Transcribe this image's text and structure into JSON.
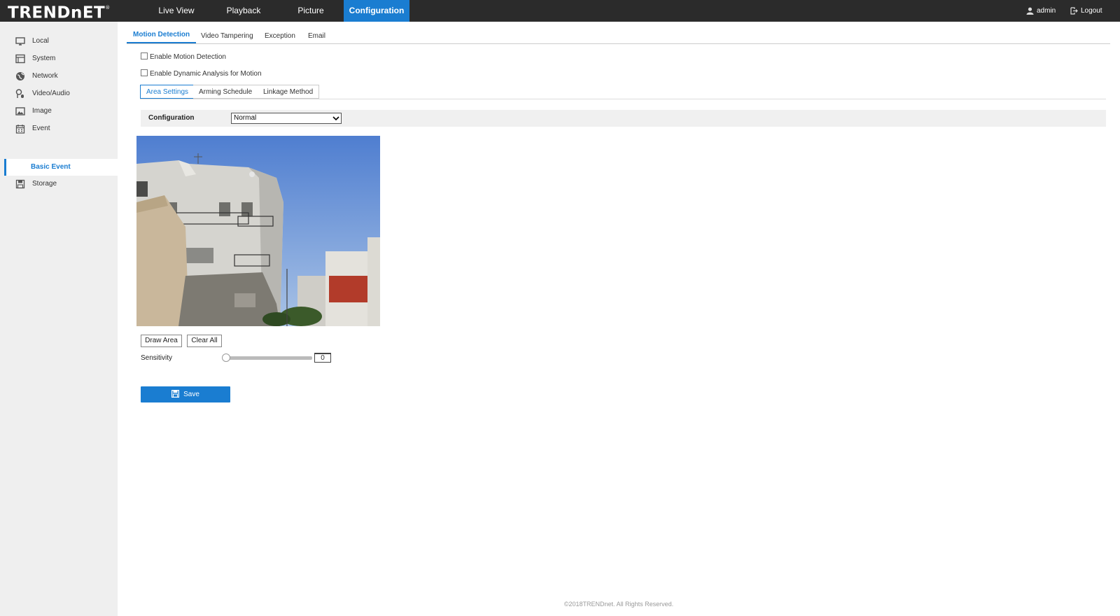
{
  "header": {
    "logo_text": "TRENDnET",
    "logo_mark": "®",
    "nav": [
      {
        "label": "Live View"
      },
      {
        "label": "Playback"
      },
      {
        "label": "Picture"
      },
      {
        "label": "Configuration",
        "active": true
      }
    ],
    "user_label": "admin",
    "logout_label": "Logout"
  },
  "sidebar": {
    "items": [
      {
        "label": "Local",
        "icon": "monitor-icon"
      },
      {
        "label": "System",
        "icon": "system-icon"
      },
      {
        "label": "Network",
        "icon": "globe-icon"
      },
      {
        "label": "Video/Audio",
        "icon": "camera-mic-icon"
      },
      {
        "label": "Image",
        "icon": "image-icon"
      },
      {
        "label": "Event",
        "icon": "calendar-icon"
      },
      {
        "label": "Storage",
        "icon": "storage-icon"
      }
    ],
    "active_sub": "Basic Event"
  },
  "tabs": [
    {
      "label": "Motion Detection",
      "active": true
    },
    {
      "label": "Video Tampering"
    },
    {
      "label": "Exception"
    },
    {
      "label": "Email"
    }
  ],
  "options": {
    "enable_motion": {
      "label": "Enable Motion Detection",
      "checked": false
    },
    "enable_dynamic": {
      "label": "Enable Dynamic Analysis for Motion",
      "checked": false
    }
  },
  "subtabs": [
    {
      "label": "Area Settings",
      "active": true
    },
    {
      "label": "Arming Schedule"
    },
    {
      "label": "Linkage Method"
    }
  ],
  "config": {
    "label": "Configuration",
    "value": "Normal"
  },
  "area_buttons": {
    "draw": "Draw Area",
    "clear": "Clear All"
  },
  "sensitivity": {
    "label": "Sensitivity",
    "value": "0",
    "level": 0
  },
  "save_label": "Save",
  "footer": "©2018TRENDnet. All Rights Reserved.",
  "colors": {
    "accent": "#1a7dd1",
    "topbar": "#2b2b2b",
    "sidebar": "#efefef"
  }
}
